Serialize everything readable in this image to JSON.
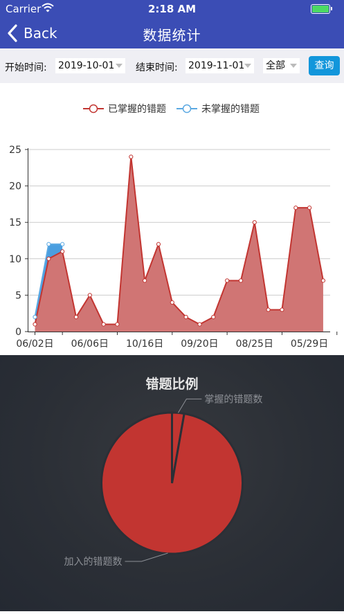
{
  "status": {
    "carrier": "Carrier",
    "time": "2:18 AM"
  },
  "nav": {
    "back_label": "Back",
    "title": "数据统计"
  },
  "filters": {
    "start_label": "开始时间:",
    "start_value": "2019-10-01",
    "end_label": "结束时间:",
    "end_value": "2019-11-01",
    "category_value": "全部",
    "query_label": "查询"
  },
  "colors": {
    "mastered": "#c23531",
    "mastered_fill": "#d07574",
    "unmastered": "#5aa8e2",
    "unmastered_fill": "#4a9ee0",
    "header": "#3b4db5",
    "query": "#1296db"
  },
  "chart_data": [
    {
      "type": "area",
      "legend": [
        "已掌握的错题",
        "未掌握的错题"
      ],
      "legend_position": "top-center",
      "ylim": [
        0,
        25
      ],
      "yticks": [
        0,
        5,
        10,
        15,
        20,
        25
      ],
      "grid": true,
      "xtick_labels": [
        "06/02日",
        "06/06日",
        "10/16日",
        "09/20日",
        "08/25日",
        "05/29日"
      ],
      "series": [
        {
          "name": "已掌握的错题",
          "values": [
            1,
            10,
            11,
            2,
            5,
            1,
            1,
            24,
            7,
            12,
            4,
            2,
            1,
            2,
            7,
            7,
            15,
            3,
            3,
            17,
            17,
            7
          ]
        },
        {
          "name": "未掌握的错题",
          "values": [
            2,
            12,
            12
          ]
        }
      ]
    },
    {
      "type": "pie",
      "title": "错题比例",
      "slices": [
        {
          "name": "掌握的错题数",
          "value": 1
        },
        {
          "name": "加入的错题数",
          "value": 35
        }
      ]
    }
  ]
}
